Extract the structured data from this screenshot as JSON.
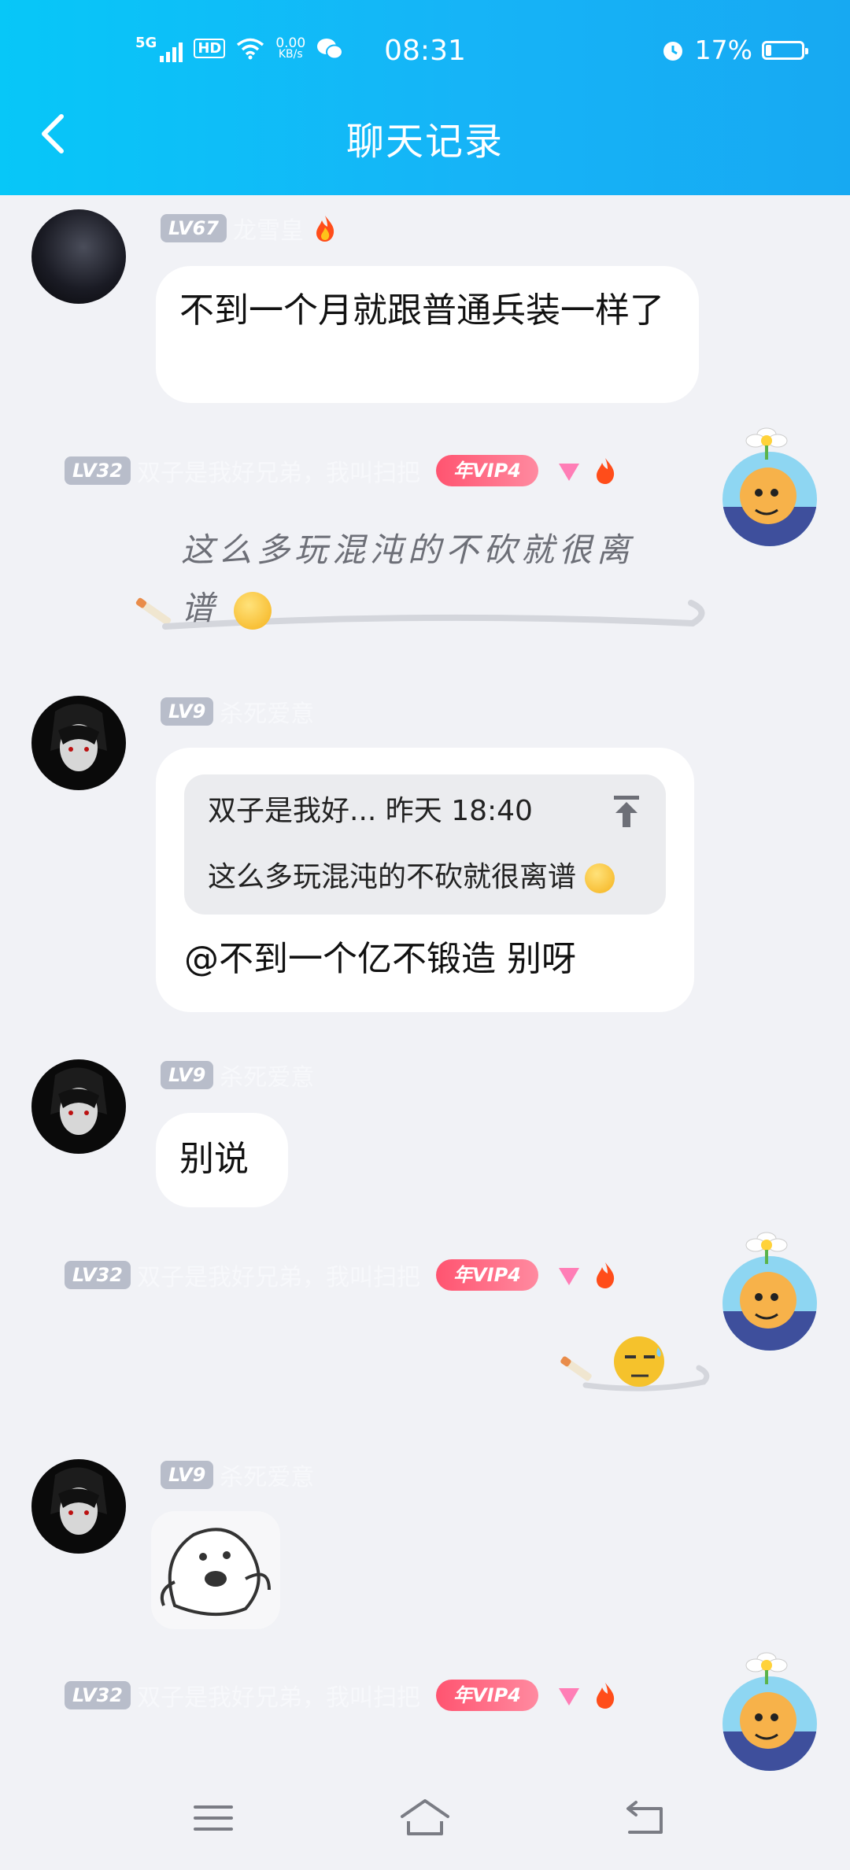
{
  "status_bar": {
    "network": "5G",
    "hd": "HD",
    "speed_value": "0.00",
    "speed_unit": "KB/s",
    "time": "08:31",
    "battery": "17%",
    "battery_fraction": 0.17
  },
  "header": {
    "title": "聊天记录"
  },
  "messages": [
    {
      "level": "LV67",
      "name": "龙雪皇",
      "text": "不到一个月就跟普通兵装一样了"
    },
    {
      "level": "LV32",
      "name": "双子是我好兄弟，我叫扫把",
      "vip": "年VIP4",
      "text_line1": "这么多玩混沌的不砍就很离",
      "text_line2": "谱"
    },
    {
      "level": "LV9",
      "name": "杀死爱意",
      "quote_header": "双子是我好... 昨天 18:40",
      "quote_body": "这么多玩混沌的不砍就很离谱",
      "text": "@不到一个亿不锻造 别呀"
    },
    {
      "level": "LV9",
      "name": "杀死爱意",
      "text": "别说"
    },
    {
      "level": "LV32",
      "name": "双子是我好兄弟，我叫扫把",
      "vip": "年VIP4"
    },
    {
      "level": "LV9",
      "name": "杀死爱意"
    },
    {
      "level": "LV32",
      "name": "双子是我好兄弟，我叫扫把",
      "vip": "年VIP4"
    }
  ]
}
